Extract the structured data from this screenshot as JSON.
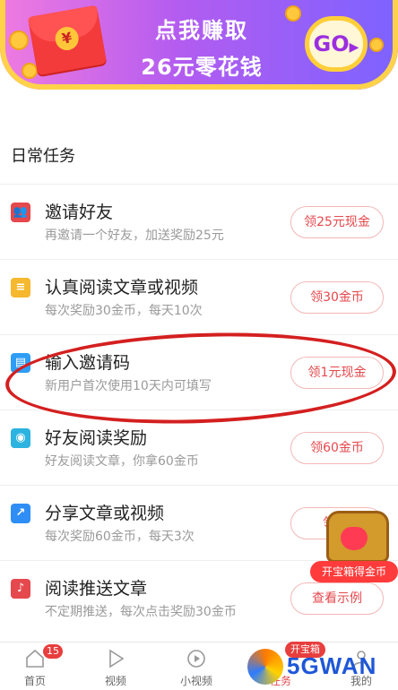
{
  "banner": {
    "line1": "点我赚取",
    "line2": "26元零花钱",
    "go_label": "GO",
    "seal": "¥"
  },
  "section_title": "日常任务",
  "tasks": [
    {
      "title": "邀请好友",
      "subtitle": "再邀请一个好友，加送奖励25元",
      "button": "领25元现金",
      "icon": "people-icon",
      "color": "#e5484d"
    },
    {
      "title": "认真阅读文章或视频",
      "subtitle": "每次奖励30金币，每天10次",
      "button": "领30金币",
      "icon": "document-icon",
      "color": "#f5b82e"
    },
    {
      "title": "输入邀请码",
      "subtitle": "新用户首次使用10天内可填写",
      "button": "领1元现金",
      "icon": "ticket-icon",
      "color": "#2e9df5"
    },
    {
      "title": "好友阅读奖励",
      "subtitle": "好友阅读文章，你拿60金币",
      "button": "领60金币",
      "icon": "eye-icon",
      "color": "#2db3e0"
    },
    {
      "title": "分享文章或视频",
      "subtitle": "每次奖励60金币，每天3次",
      "button": "领60",
      "icon": "share-icon",
      "color": "#2e8ef5"
    },
    {
      "title": "阅读推送文章",
      "subtitle": "不定期推送，每次点击奖励30金币",
      "button": "查看示例",
      "icon": "bell-icon",
      "color": "#e5484d"
    }
  ],
  "treasure": {
    "label": "开宝箱得金币"
  },
  "nav": {
    "items": [
      {
        "label": "首页",
        "icon": "home-icon"
      },
      {
        "label": "视频",
        "icon": "play-icon"
      },
      {
        "label": "小视频",
        "icon": "short-video-icon"
      },
      {
        "label": "任务",
        "icon": "task-icon"
      },
      {
        "label": "我的",
        "icon": "profile-icon"
      }
    ],
    "home_badge": "15",
    "box_badge": "开宝箱"
  },
  "watermark": {
    "text": "5GWAN"
  },
  "colors": {
    "accent": "#e5484d",
    "banner_left": "#f07be0",
    "banner_right": "#7d63ff",
    "gold": "#ffcf3a"
  }
}
